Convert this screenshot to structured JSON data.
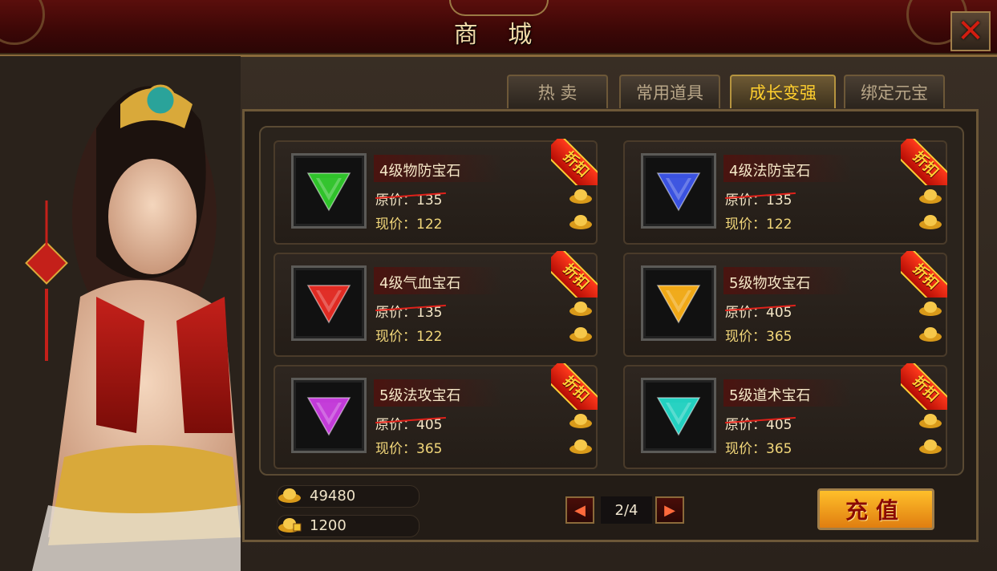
{
  "window": {
    "title": "商 城"
  },
  "tabs": [
    {
      "label": "热 卖",
      "active": false
    },
    {
      "label": "常用道具",
      "active": false
    },
    {
      "label": "成长变强",
      "active": true
    },
    {
      "label": "绑定元宝",
      "active": false
    }
  ],
  "items": [
    {
      "name": "4级物防宝石",
      "original_label": "原价：",
      "original_price": "135",
      "current_label": "现价：",
      "current_price": "122",
      "badge": "折扣",
      "gem_color": "#2fc22a",
      "gem_icon": "green-gem-icon"
    },
    {
      "name": "4级法防宝石",
      "original_label": "原价：",
      "original_price": "135",
      "current_label": "现价：",
      "current_price": "122",
      "badge": "折扣",
      "gem_color": "#3a52e0",
      "gem_icon": "blue-gem-icon"
    },
    {
      "name": "4级气血宝石",
      "original_label": "原价：",
      "original_price": "135",
      "current_label": "现价：",
      "current_price": "122",
      "badge": "折扣",
      "gem_color": "#e02a22",
      "gem_icon": "red-gem-icon"
    },
    {
      "name": "5级物攻宝石",
      "original_label": "原价：",
      "original_price": "405",
      "current_label": "现价：",
      "current_price": "365",
      "badge": "折扣",
      "gem_color": "#f0a816",
      "gem_icon": "orange-gem-icon"
    },
    {
      "name": "5级法攻宝石",
      "original_label": "原价：",
      "original_price": "405",
      "current_label": "现价：",
      "current_price": "365",
      "badge": "折扣",
      "gem_color": "#c23ad8",
      "gem_icon": "purple-gem-icon"
    },
    {
      "name": "5级道术宝石",
      "original_label": "原价：",
      "original_price": "405",
      "current_label": "现价：",
      "current_price": "365",
      "badge": "折扣",
      "gem_color": "#22d0c0",
      "gem_icon": "cyan-gem-icon"
    }
  ],
  "currency": {
    "gold": "49480",
    "bound_gold": "1200"
  },
  "pagination": {
    "text": "2/4"
  },
  "recharge": {
    "label": "充值"
  }
}
